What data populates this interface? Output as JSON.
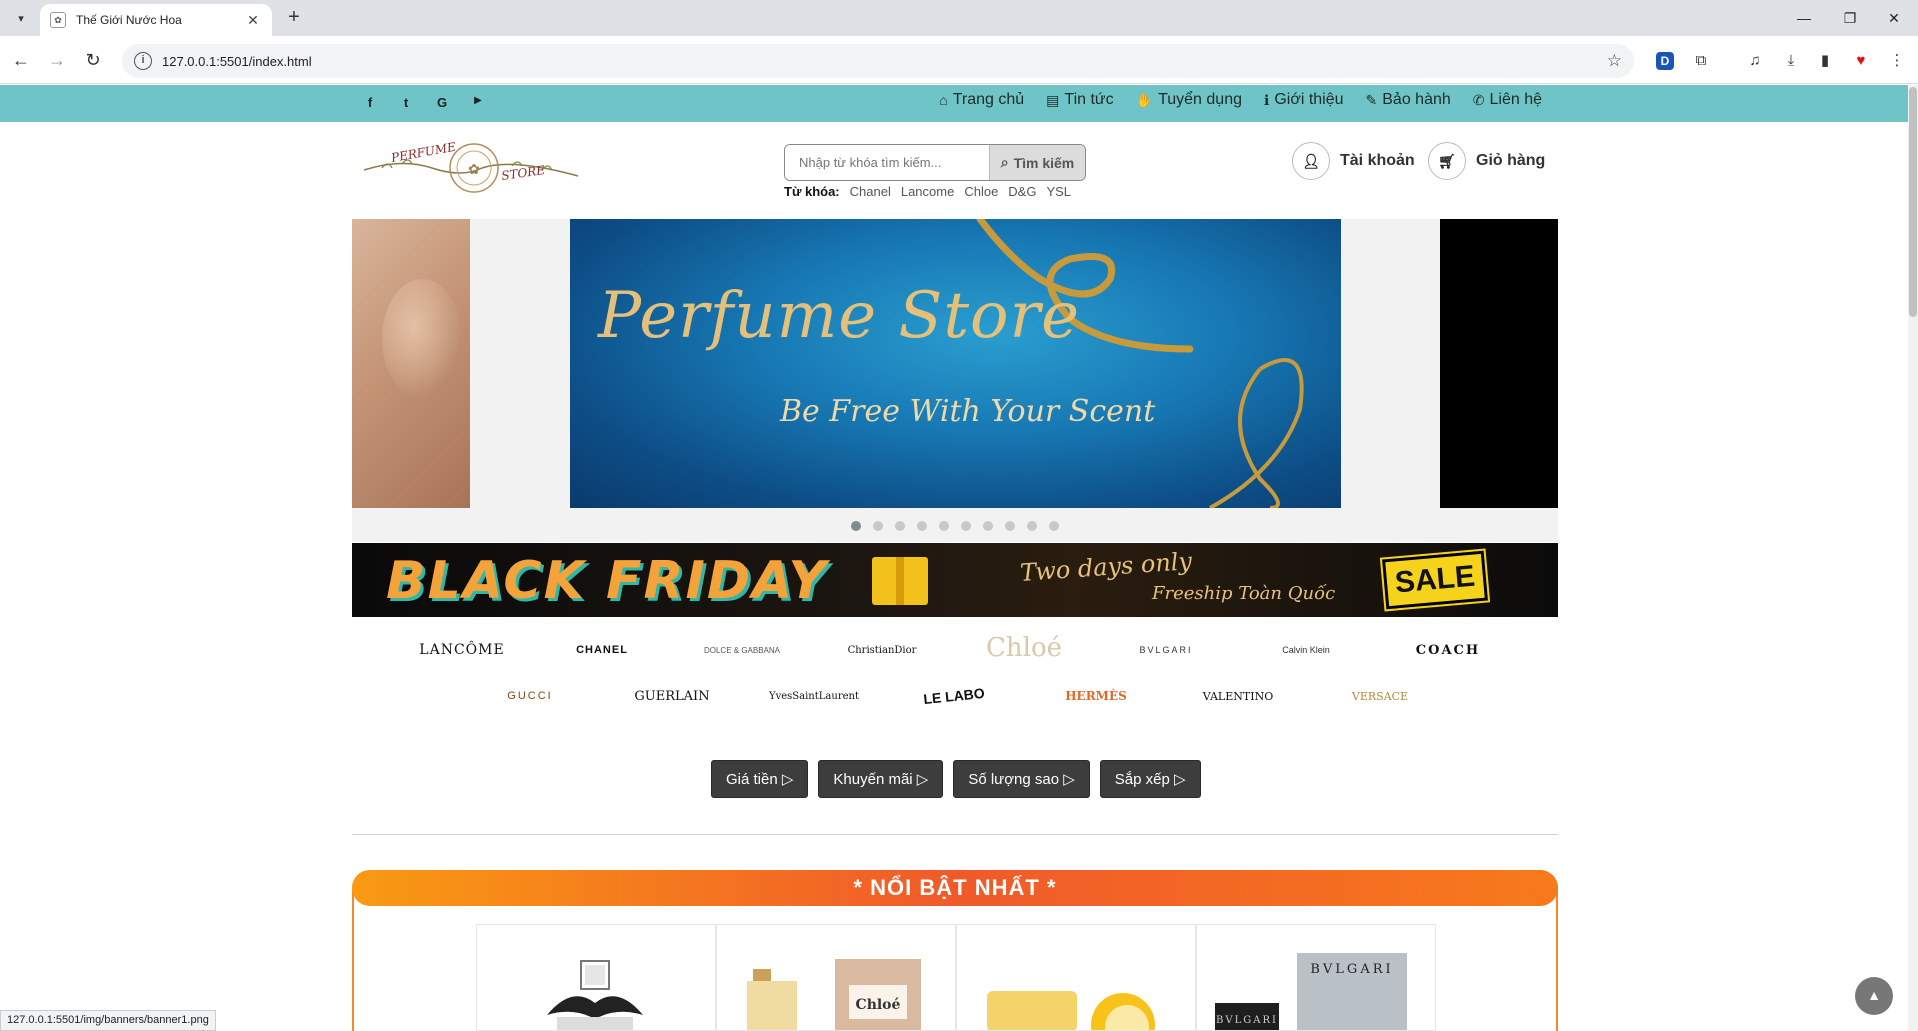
{
  "browser": {
    "tab_title": "Thế Giới Nước Hoa",
    "url": "127.0.0.1:5501/index.html",
    "status_url": "127.0.0.1:5501/img/banners/banner1.png"
  },
  "topbar": {
    "social": [
      "f",
      "t",
      "G",
      "▶"
    ],
    "nav": [
      {
        "icon": "home-icon",
        "glyph": "⌂",
        "label": "Trang chủ"
      },
      {
        "icon": "newspaper-icon",
        "glyph": "▤",
        "label": "Tin tức"
      },
      {
        "icon": "handshake-icon",
        "glyph": "✋",
        "label": "Tuyển dụng"
      },
      {
        "icon": "info-icon",
        "glyph": "ℹ",
        "label": "Giới thiệu"
      },
      {
        "icon": "wrench-icon",
        "glyph": "✎",
        "label": "Bảo hành"
      },
      {
        "icon": "phone-icon",
        "glyph": "✆",
        "label": "Liên hệ"
      }
    ]
  },
  "header": {
    "logo_left": "PERFUME",
    "logo_right": "STORE",
    "search_placeholder": "Nhập từ khóa tìm kiếm...",
    "search_button": "Tìm kiếm",
    "keywords_label": "Từ khóa:",
    "keywords": [
      "Chanel",
      "Lancome",
      "Chloe",
      "D&G",
      "YSL"
    ],
    "account_label": "Tài khoản",
    "cart_label": "Giỏ hàng"
  },
  "carousel": {
    "title": "Perfume Store",
    "subtitle": "Be Free With Your Scent",
    "dot_count": 10,
    "active_dot": 0
  },
  "black_friday": {
    "title": "BLACK FRIDAY",
    "tagline": "Two days only",
    "sub": "Freeship Toàn Quốc",
    "badge": "SALE"
  },
  "brands": {
    "row1": [
      "LANCÔME",
      "CHANEL",
      "DOLCE & GABBANA",
      "ChristianDior",
      "Chloé",
      "BVLGARI",
      "Calvin Klein",
      "COACH"
    ],
    "row2": [
      "GUCCI",
      "GUERLAIN",
      "YvesSaintLaurent",
      "LE LABO",
      "HERMÈS",
      "VALENTINO",
      "VERSACE"
    ]
  },
  "filters": [
    "Giá tiền ▷",
    "Khuyến mãi ▷",
    "Số lượng sao ▷",
    "Sắp xếp ▷"
  ],
  "featured": {
    "title": "* NỔI BẬT NHẤT *"
  },
  "products": [
    {
      "label": ""
    },
    {
      "label": "Chloé"
    },
    {
      "label": ""
    },
    {
      "label": "BVLGARI"
    }
  ]
}
